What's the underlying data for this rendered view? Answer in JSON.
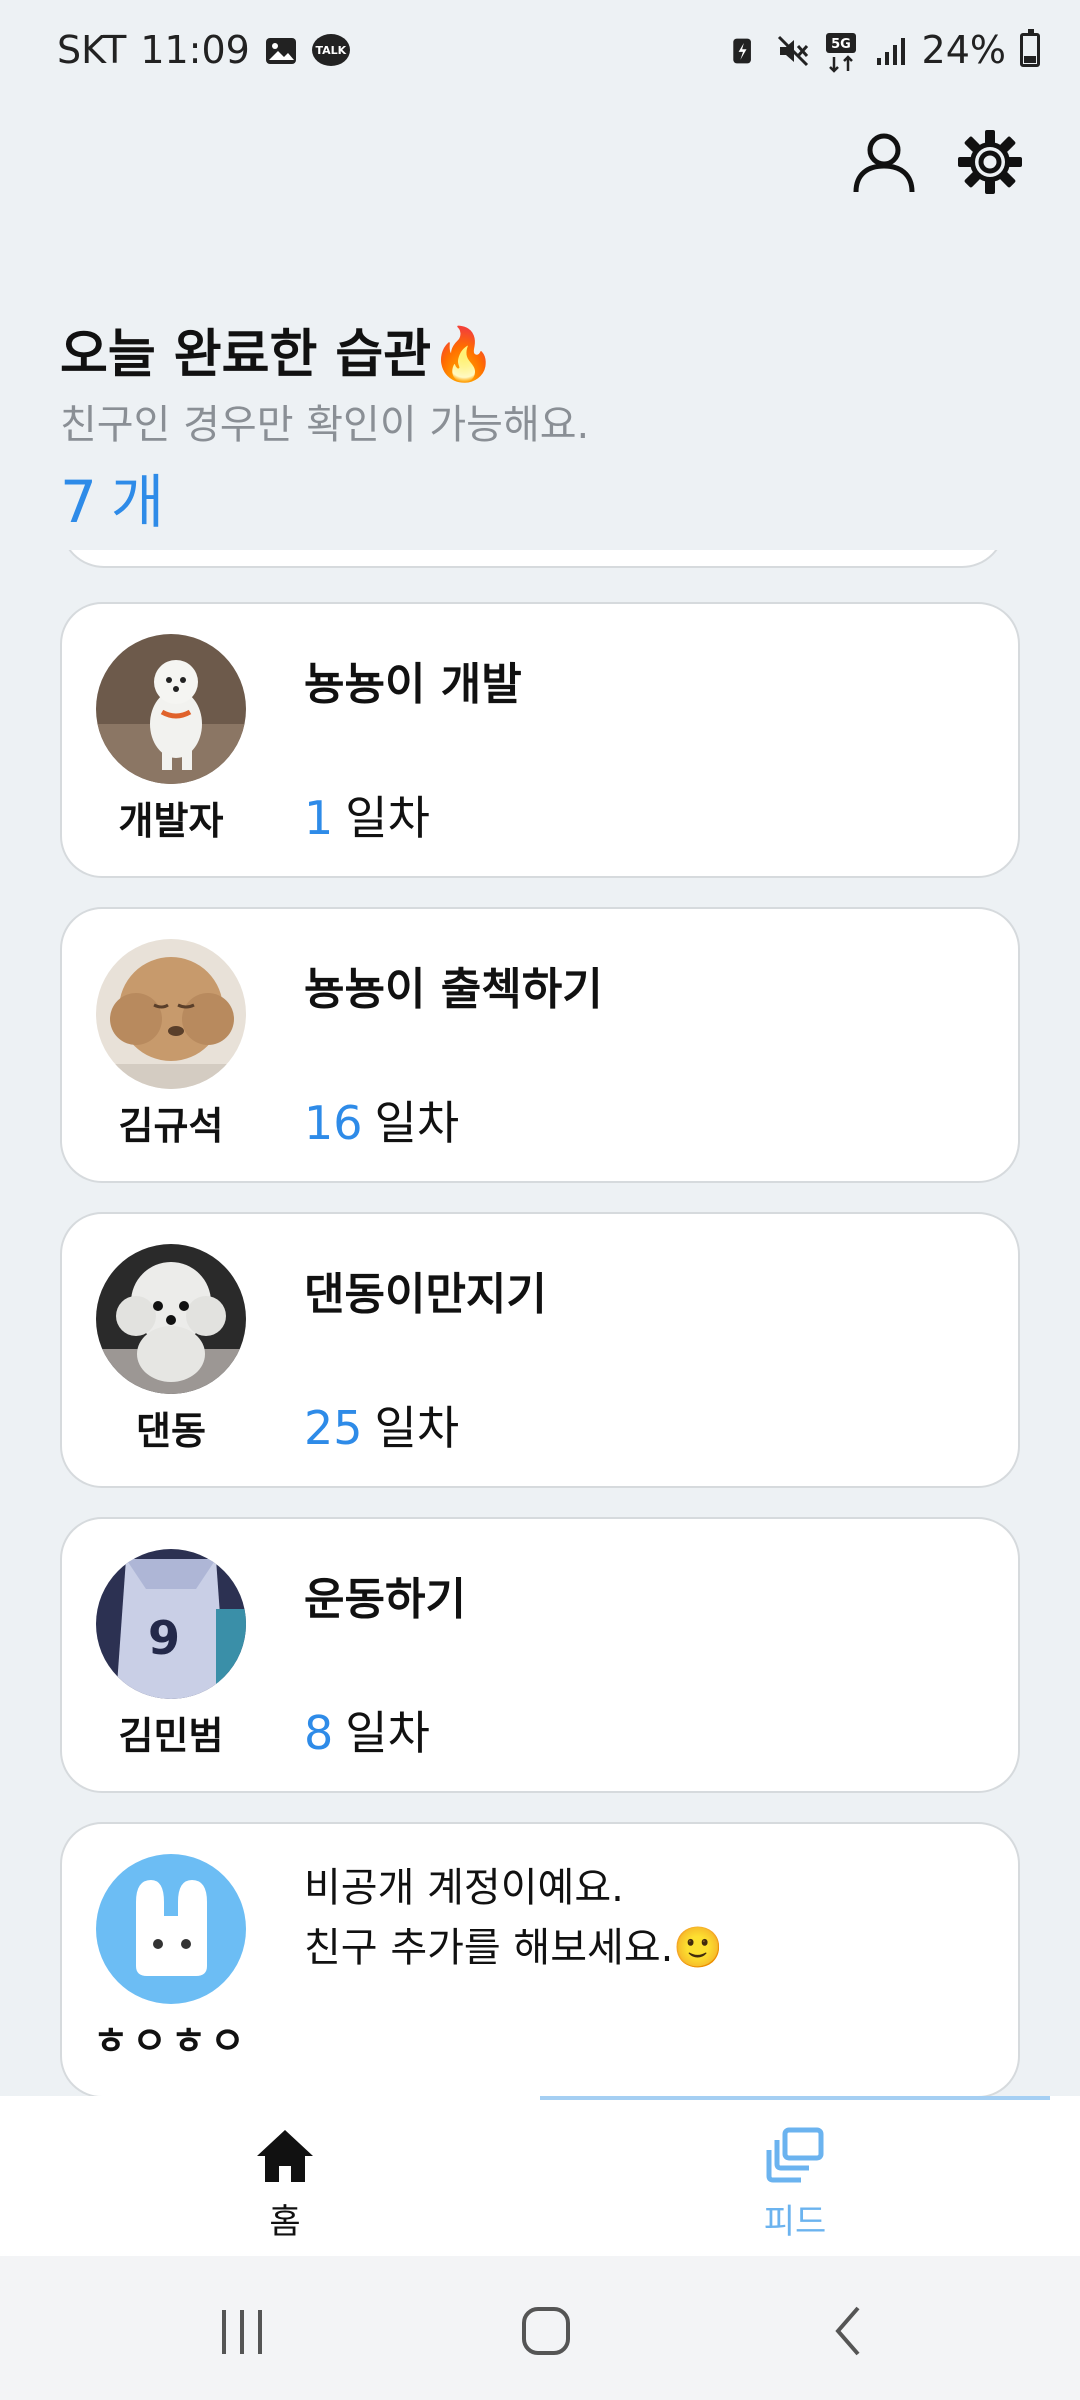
{
  "status_bar": {
    "carrier": "SKT",
    "time": "11:09",
    "battery": "24%",
    "talk": "TALK",
    "network": "5G"
  },
  "header": {
    "title": "오늘 완료한 습관🔥",
    "subtitle": "친구인 경우만 확인이 가능해요.",
    "count_number": "7",
    "count_unit": "개"
  },
  "cards": [
    {
      "user": "개발자",
      "habit": "뇽뇽이 개발",
      "days": "1",
      "day_unit": "일차"
    },
    {
      "user": "김규석",
      "habit": "뇽뇽이 출첵하기",
      "days": "16",
      "day_unit": "일차"
    },
    {
      "user": "댄동",
      "habit": "댄동이만지기",
      "days": "25",
      "day_unit": "일차"
    },
    {
      "user": "김민범",
      "habit": "운동하기",
      "days": "8",
      "day_unit": "일차"
    }
  ],
  "private_card": {
    "user": "ㅎㅇㅎㅇ",
    "line1": "비공개 계정이예요.",
    "line2": "친구 추가를 해보세요.🙂"
  },
  "bottom_nav": [
    {
      "label": "홈",
      "icon": "home-icon",
      "active": false
    },
    {
      "label": "피드",
      "icon": "feed-icon",
      "active": true
    }
  ],
  "colors": {
    "accent": "#2e8be8",
    "background": "#edf1f4",
    "nav_active": "#6bb3ef"
  }
}
